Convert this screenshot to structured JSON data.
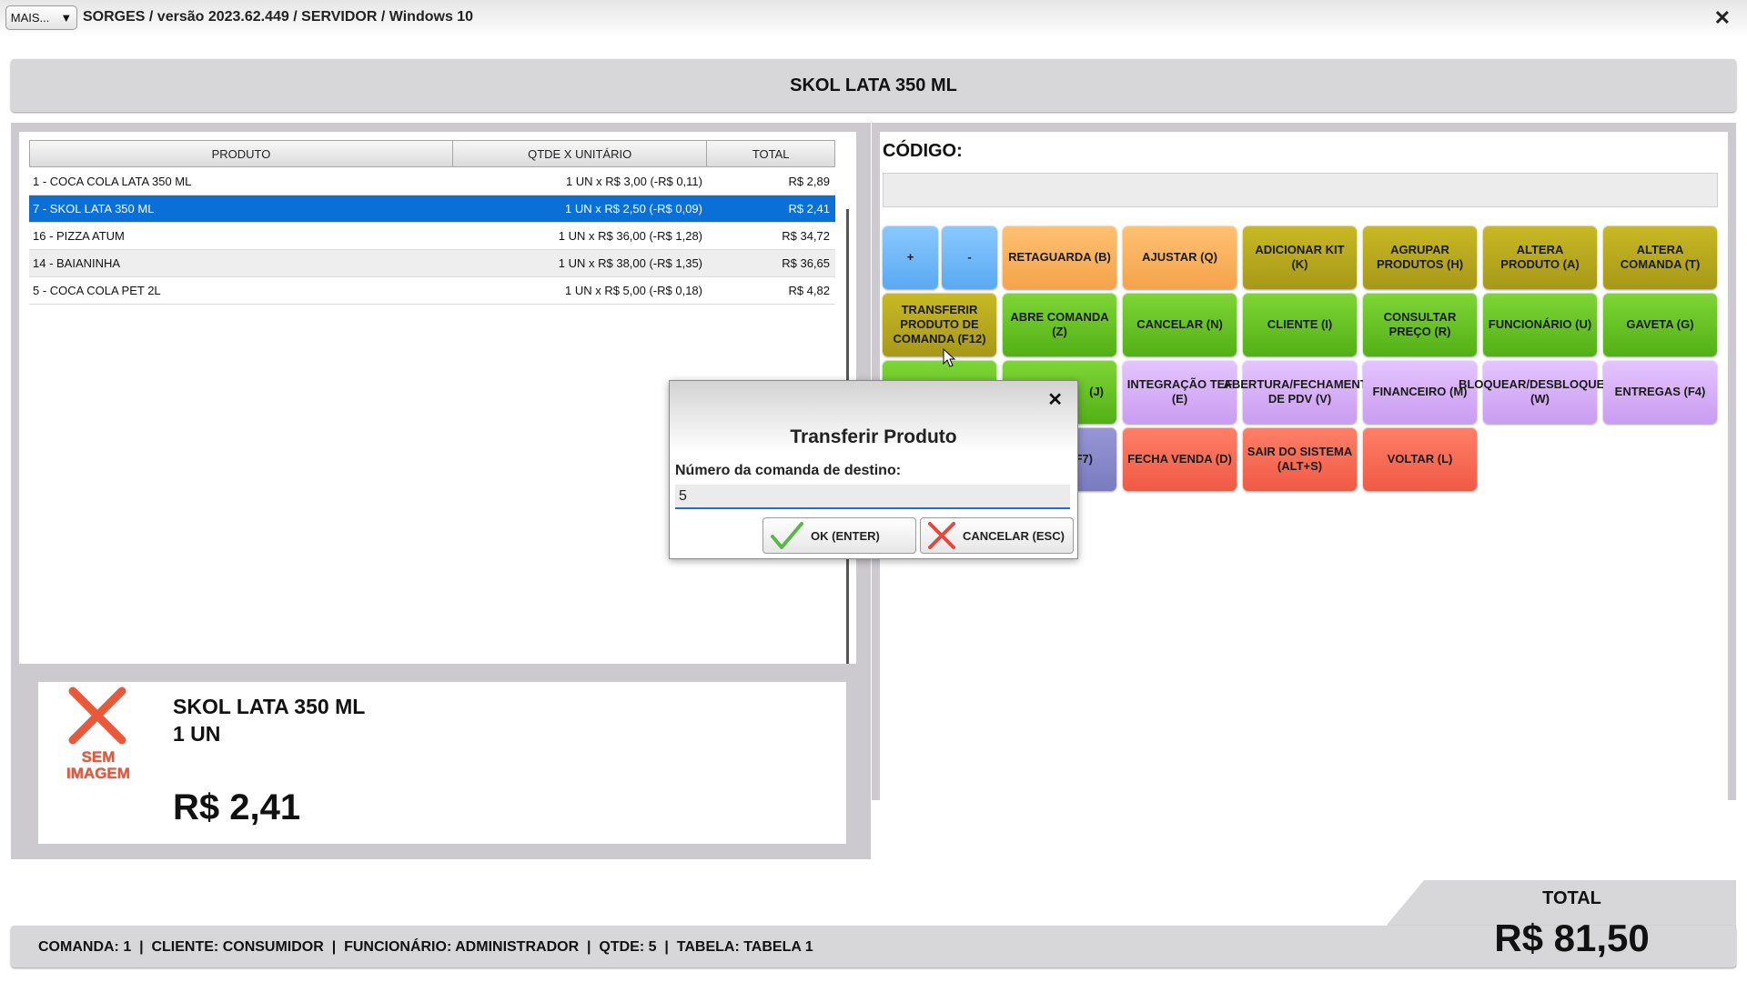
{
  "titlebar": {
    "menu_label": "MAIS...",
    "menu_arrow": "▼",
    "title": "SORGES / versão 2023.62.449 / SERVIDOR / Windows 10",
    "close": "✕"
  },
  "header": {
    "product_name": "SKOL LATA 350 ML"
  },
  "table": {
    "headers": [
      "PRODUTO",
      "QTDE X UNITÁRIO",
      "TOTAL"
    ],
    "rows": [
      {
        "produto": "1 - COCA COLA LATA 350 ML",
        "qtde": "1 UN x R$ 3,00 (-R$ 0,11)",
        "total": "R$ 2,89",
        "selected": false
      },
      {
        "produto": "7 - SKOL LATA 350 ML",
        "qtde": "1 UN x R$ 2,50 (-R$ 0,09)",
        "total": "R$ 2,41",
        "selected": true
      },
      {
        "produto": "16 - PIZZA ATUM",
        "qtde": "1 UN x R$ 36,00 (-R$ 1,28)",
        "total": "R$ 34,72",
        "selected": false
      },
      {
        "produto": "14 - BAIANINHA",
        "qtde": "1 UN x R$ 38,00 (-R$ 1,35)",
        "total": "R$ 36,65",
        "selected": false
      },
      {
        "produto": "5 - COCA COLA PET 2L",
        "qtde": "1 UN x R$ 5,00 (-R$ 0,18)",
        "total": "R$ 4,82",
        "selected": false
      }
    ]
  },
  "product_card": {
    "no_image": "SEM IMAGEM",
    "name": "SKOL LATA 350 ML",
    "qty": "1  UN",
    "price": "R$ 2,41"
  },
  "codigo": {
    "label": "CÓDIGO:",
    "value": ""
  },
  "buttons": {
    "plus": "+",
    "minus": "-",
    "retaguarda": "RETAGUARDA (B)",
    "ajustar": "AJUSTAR (Q)",
    "adicionar_kit": "ADICIONAR KIT (K)",
    "agrupar": "AGRUPAR PRODUTOS (H)",
    "altera_produto": "ALTERA PRODUTO (A)",
    "altera_comanda": "ALTERA COMANDA (T)",
    "transferir": "TRANSFERIR PRODUTO DE COMANDA (F12)",
    "abre_comanda": "ABRE COMANDA (Z)",
    "cancelar": "CANCELAR (N)",
    "cliente": "CLIENTE (I)",
    "consultar_preco": "CONSULTAR PREÇO (R)",
    "funcionario": "FUNCIONÁRIO (U)",
    "gaveta": "GAVETA (G)",
    "j_partial": "(J)",
    "integracao_tef": "INTEGRAÇÃO TEF (E)",
    "abertura_pdv": "ABERTURA/FECHAMENTO DE PDV (V)",
    "financeiro": "FINANCEIRO (M)",
    "bloquear": "BLOQUEAR/DESBLOQUEAR (W)",
    "entregas": "ENTREGAS (F4)",
    "f7_partial": "(F7)",
    "fecha_venda": "FECHA VENDA (D)",
    "sair": "SAIR DO SISTEMA (ALT+S)",
    "voltar": "VOLTAR (L)"
  },
  "dialog": {
    "close": "✕",
    "title": "Transferir Produto",
    "label": "Número da comanda de destino:",
    "value": "5",
    "ok_label": "OK (ENTER)",
    "cancel_label": "CANCELAR (ESC)"
  },
  "status": {
    "text": "COMANDA: 1  |  CLIENTE: CONSUMIDOR  |  FUNCIONÁRIO: ADMINISTRADOR  |  QTDE: 5  |  TABELA: TABELA 1"
  },
  "total": {
    "label": "TOTAL",
    "value": "R$ 81,50"
  },
  "colors": {
    "selection": "#0b6fd8",
    "orange": "#f5a34a",
    "olive": "#a79918",
    "green": "#52b016",
    "purple": "#c99cf0",
    "red": "#f05a44",
    "blue": "#5aa9f2"
  }
}
